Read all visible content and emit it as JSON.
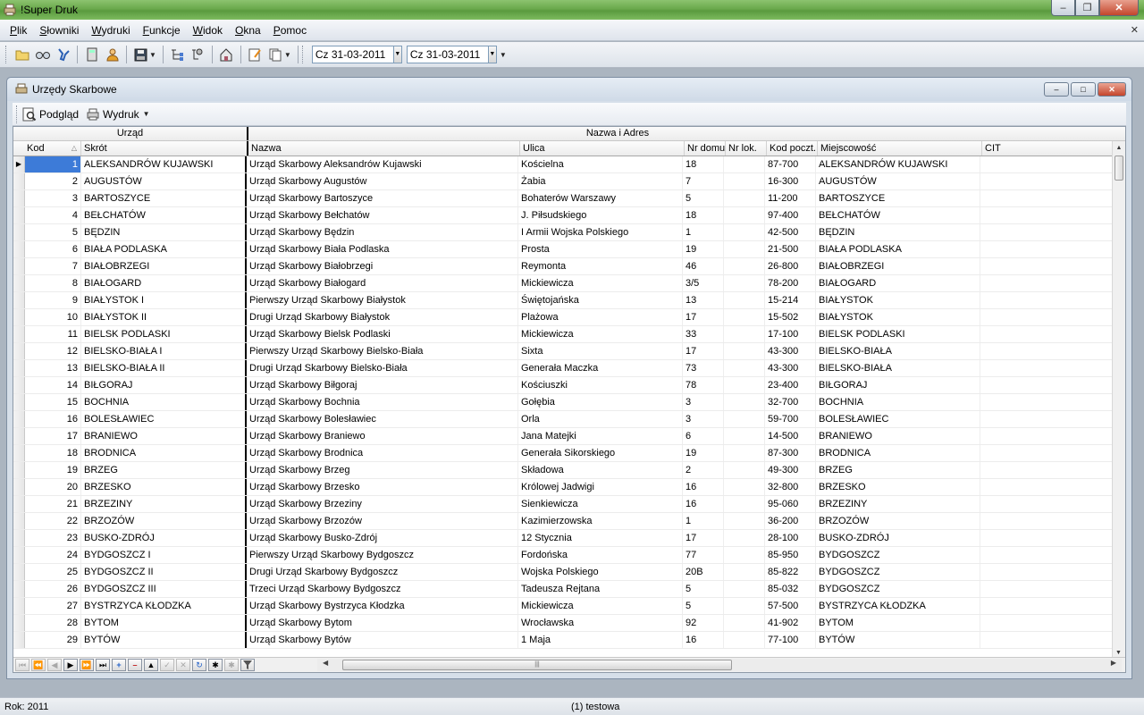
{
  "app": {
    "title": "!Super Druk"
  },
  "menu": [
    "Plik",
    "Słowniki",
    "Wydruki",
    "Funkcje",
    "Widok",
    "Okna",
    "Pomoc"
  ],
  "toolbar": {
    "date_from": "Cz 31-03-2011",
    "date_to": "Cz 31-03-2011"
  },
  "child": {
    "title": "Urzędy Skarbowe",
    "preview_label": "Podgląd",
    "print_label": "Wydruk"
  },
  "grid": {
    "band_urzad": "Urząd",
    "band_nazwa_adres": "Nazwa i Adres",
    "headers": {
      "kod": "Kod",
      "skrot": "Skrót",
      "nazwa": "Nazwa",
      "ulica": "Ulica",
      "nr_domu": "Nr domu",
      "nr_lok": "Nr lok.",
      "kod_poczt": "Kod poczt.",
      "miejscowosc": "Miejscowość",
      "cit": "CIT"
    },
    "rows": [
      {
        "kod": "1",
        "skrot": "ALEKSANDRÓW KUJAWSKI",
        "nazwa": "Urząd Skarbowy Aleksandrów Kujawski",
        "ulica": "Kościelna",
        "nr_domu": "18",
        "kod_poczt": "87-700",
        "miejscowosc": "ALEKSANDRÓW KUJAWSKI"
      },
      {
        "kod": "2",
        "skrot": "AUGUSTÓW",
        "nazwa": "Urząd Skarbowy Augustów",
        "ulica": "Żabia",
        "nr_domu": "7",
        "kod_poczt": "16-300",
        "miejscowosc": "AUGUSTÓW"
      },
      {
        "kod": "3",
        "skrot": "BARTOSZYCE",
        "nazwa": "Urząd Skarbowy Bartoszyce",
        "ulica": "Bohaterów Warszawy",
        "nr_domu": "5",
        "kod_poczt": "11-200",
        "miejscowosc": "BARTOSZYCE"
      },
      {
        "kod": "4",
        "skrot": "BEŁCHATÓW",
        "nazwa": "Urząd Skarbowy Bełchatów",
        "ulica": "J. Piłsudskiego",
        "nr_domu": "18",
        "kod_poczt": "97-400",
        "miejscowosc": "BEŁCHATÓW"
      },
      {
        "kod": "5",
        "skrot": "BĘDZIN",
        "nazwa": "Urząd Skarbowy Będzin",
        "ulica": "I Armii Wojska Polskiego",
        "nr_domu": "1",
        "kod_poczt": "42-500",
        "miejscowosc": "BĘDZIN"
      },
      {
        "kod": "6",
        "skrot": "BIAŁA PODLASKA",
        "nazwa": "Urząd Skarbowy Biała Podlaska",
        "ulica": "Prosta",
        "nr_domu": "19",
        "kod_poczt": "21-500",
        "miejscowosc": "BIAŁA PODLASKA"
      },
      {
        "kod": "7",
        "skrot": "BIAŁOBRZEGI",
        "nazwa": "Urząd Skarbowy Białobrzegi",
        "ulica": "Reymonta",
        "nr_domu": "46",
        "kod_poczt": "26-800",
        "miejscowosc": "BIAŁOBRZEGI"
      },
      {
        "kod": "8",
        "skrot": "BIAŁOGARD",
        "nazwa": "Urząd Skarbowy Białogard",
        "ulica": "Mickiewicza",
        "nr_domu": "3/5",
        "kod_poczt": "78-200",
        "miejscowosc": "BIAŁOGARD"
      },
      {
        "kod": "9",
        "skrot": "BIAŁYSTOK I",
        "nazwa": "Pierwszy Urząd Skarbowy Białystok",
        "ulica": "Świętojańska",
        "nr_domu": "13",
        "kod_poczt": "15-214",
        "miejscowosc": "BIAŁYSTOK"
      },
      {
        "kod": "10",
        "skrot": "BIAŁYSTOK II",
        "nazwa": "Drugi Urząd Skarbowy Białystok",
        "ulica": "Plażowa",
        "nr_domu": "17",
        "kod_poczt": "15-502",
        "miejscowosc": "BIAŁYSTOK"
      },
      {
        "kod": "11",
        "skrot": "BIELSK PODLASKI",
        "nazwa": "Urząd Skarbowy Bielsk Podlaski",
        "ulica": "Mickiewicza",
        "nr_domu": "33",
        "kod_poczt": "17-100",
        "miejscowosc": "BIELSK PODLASKI"
      },
      {
        "kod": "12",
        "skrot": "BIELSKO-BIAŁA I",
        "nazwa": "Pierwszy Urząd Skarbowy Bielsko-Biała",
        "ulica": "Sixta",
        "nr_domu": "17",
        "kod_poczt": "43-300",
        "miejscowosc": "BIELSKO-BIAŁA"
      },
      {
        "kod": "13",
        "skrot": "BIELSKO-BIAŁA II",
        "nazwa": "Drugi Urząd Skarbowy Bielsko-Biała",
        "ulica": "Generała Maczka",
        "nr_domu": "73",
        "kod_poczt": "43-300",
        "miejscowosc": "BIELSKO-BIAŁA"
      },
      {
        "kod": "14",
        "skrot": "BIŁGORAJ",
        "nazwa": "Urząd Skarbowy Biłgoraj",
        "ulica": "Kościuszki",
        "nr_domu": "78",
        "kod_poczt": "23-400",
        "miejscowosc": "BIŁGORAJ"
      },
      {
        "kod": "15",
        "skrot": "BOCHNIA",
        "nazwa": "Urząd Skarbowy Bochnia",
        "ulica": "Gołębia",
        "nr_domu": "3",
        "kod_poczt": "32-700",
        "miejscowosc": "BOCHNIA"
      },
      {
        "kod": "16",
        "skrot": "BOLESŁAWIEC",
        "nazwa": "Urząd Skarbowy Bolesławiec",
        "ulica": "Orla",
        "nr_domu": "3",
        "kod_poczt": "59-700",
        "miejscowosc": "BOLESŁAWIEC"
      },
      {
        "kod": "17",
        "skrot": "BRANIEWO",
        "nazwa": "Urząd Skarbowy Braniewo",
        "ulica": "Jana Matejki",
        "nr_domu": "6",
        "kod_poczt": "14-500",
        "miejscowosc": "BRANIEWO"
      },
      {
        "kod": "18",
        "skrot": "BRODNICA",
        "nazwa": "Urząd Skarbowy Brodnica",
        "ulica": "Generała Sikorskiego",
        "nr_domu": "19",
        "kod_poczt": "87-300",
        "miejscowosc": "BRODNICA"
      },
      {
        "kod": "19",
        "skrot": "BRZEG",
        "nazwa": "Urząd Skarbowy Brzeg",
        "ulica": "Składowa",
        "nr_domu": "2",
        "kod_poczt": "49-300",
        "miejscowosc": "BRZEG"
      },
      {
        "kod": "20",
        "skrot": "BRZESKO",
        "nazwa": "Urząd Skarbowy Brzesko",
        "ulica": "Królowej Jadwigi",
        "nr_domu": "16",
        "kod_poczt": "32-800",
        "miejscowosc": "BRZESKO"
      },
      {
        "kod": "21",
        "skrot": "BRZEZINY",
        "nazwa": "Urząd Skarbowy Brzeziny",
        "ulica": "Sienkiewicza",
        "nr_domu": "16",
        "kod_poczt": "95-060",
        "miejscowosc": "BRZEZINY"
      },
      {
        "kod": "22",
        "skrot": "BRZOZÓW",
        "nazwa": "Urząd Skarbowy Brzozów",
        "ulica": "Kazimierzowska",
        "nr_domu": "1",
        "kod_poczt": "36-200",
        "miejscowosc": "BRZOZÓW"
      },
      {
        "kod": "23",
        "skrot": "BUSKO-ZDRÓJ",
        "nazwa": "Urząd Skarbowy Busko-Zdrój",
        "ulica": "12 Stycznia",
        "nr_domu": "17",
        "kod_poczt": "28-100",
        "miejscowosc": "BUSKO-ZDRÓJ"
      },
      {
        "kod": "24",
        "skrot": "BYDGOSZCZ I",
        "nazwa": "Pierwszy Urząd Skarbowy Bydgoszcz",
        "ulica": "Fordońska",
        "nr_domu": "77",
        "kod_poczt": "85-950",
        "miejscowosc": "BYDGOSZCZ"
      },
      {
        "kod": "25",
        "skrot": "BYDGOSZCZ II",
        "nazwa": "Drugi Urząd Skarbowy Bydgoszcz",
        "ulica": "Wojska Polskiego",
        "nr_domu": "20B",
        "kod_poczt": "85-822",
        "miejscowosc": "BYDGOSZCZ"
      },
      {
        "kod": "26",
        "skrot": "BYDGOSZCZ III",
        "nazwa": "Trzeci Urząd Skarbowy Bydgoszcz",
        "ulica": "Tadeusza Rejtana",
        "nr_domu": "5",
        "kod_poczt": "85-032",
        "miejscowosc": "BYDGOSZCZ"
      },
      {
        "kod": "27",
        "skrot": "BYSTRZYCA KŁODZKA",
        "nazwa": "Urząd Skarbowy Bystrzyca Kłodzka",
        "ulica": "Mickiewicza",
        "nr_domu": "5",
        "kod_poczt": "57-500",
        "miejscowosc": "BYSTRZYCA KŁODZKA"
      },
      {
        "kod": "28",
        "skrot": "BYTOM",
        "nazwa": "Urząd Skarbowy Bytom",
        "ulica": "Wrocławska",
        "nr_domu": "92",
        "kod_poczt": "41-902",
        "miejscowosc": "BYTOM"
      },
      {
        "kod": "29",
        "skrot": "BYTÓW",
        "nazwa": "Urząd Skarbowy Bytów",
        "ulica": "1 Maja",
        "nr_domu": "16",
        "kod_poczt": "77-100",
        "miejscowosc": "BYTÓW"
      }
    ]
  },
  "status": {
    "year": "Rok: 2011",
    "user": "(1) testowa"
  }
}
